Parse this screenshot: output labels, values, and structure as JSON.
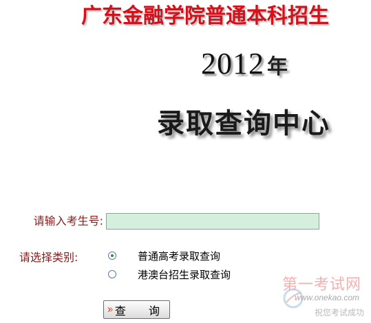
{
  "header": {
    "school_title": "广东金融学院普通本科招生",
    "year": "2012",
    "year_suffix": "年",
    "center_title": "录取查询中心"
  },
  "form": {
    "exam_id_label": "请输入考生号:",
    "exam_id_value": "",
    "category_label": "请选择类别:",
    "options": [
      {
        "label": "普通高考录取查询",
        "selected": true
      },
      {
        "label": "港澳台招生录取查询",
        "selected": false
      }
    ],
    "submit_label": "查 询"
  },
  "watermark": {
    "title": "第一考试网",
    "url": "www.onekao.com",
    "slogan": "祝您考试成功"
  },
  "colors": {
    "title_red": "#d4101a",
    "label_brown": "#8b1a1a",
    "input_bg": "#d5eedd"
  }
}
